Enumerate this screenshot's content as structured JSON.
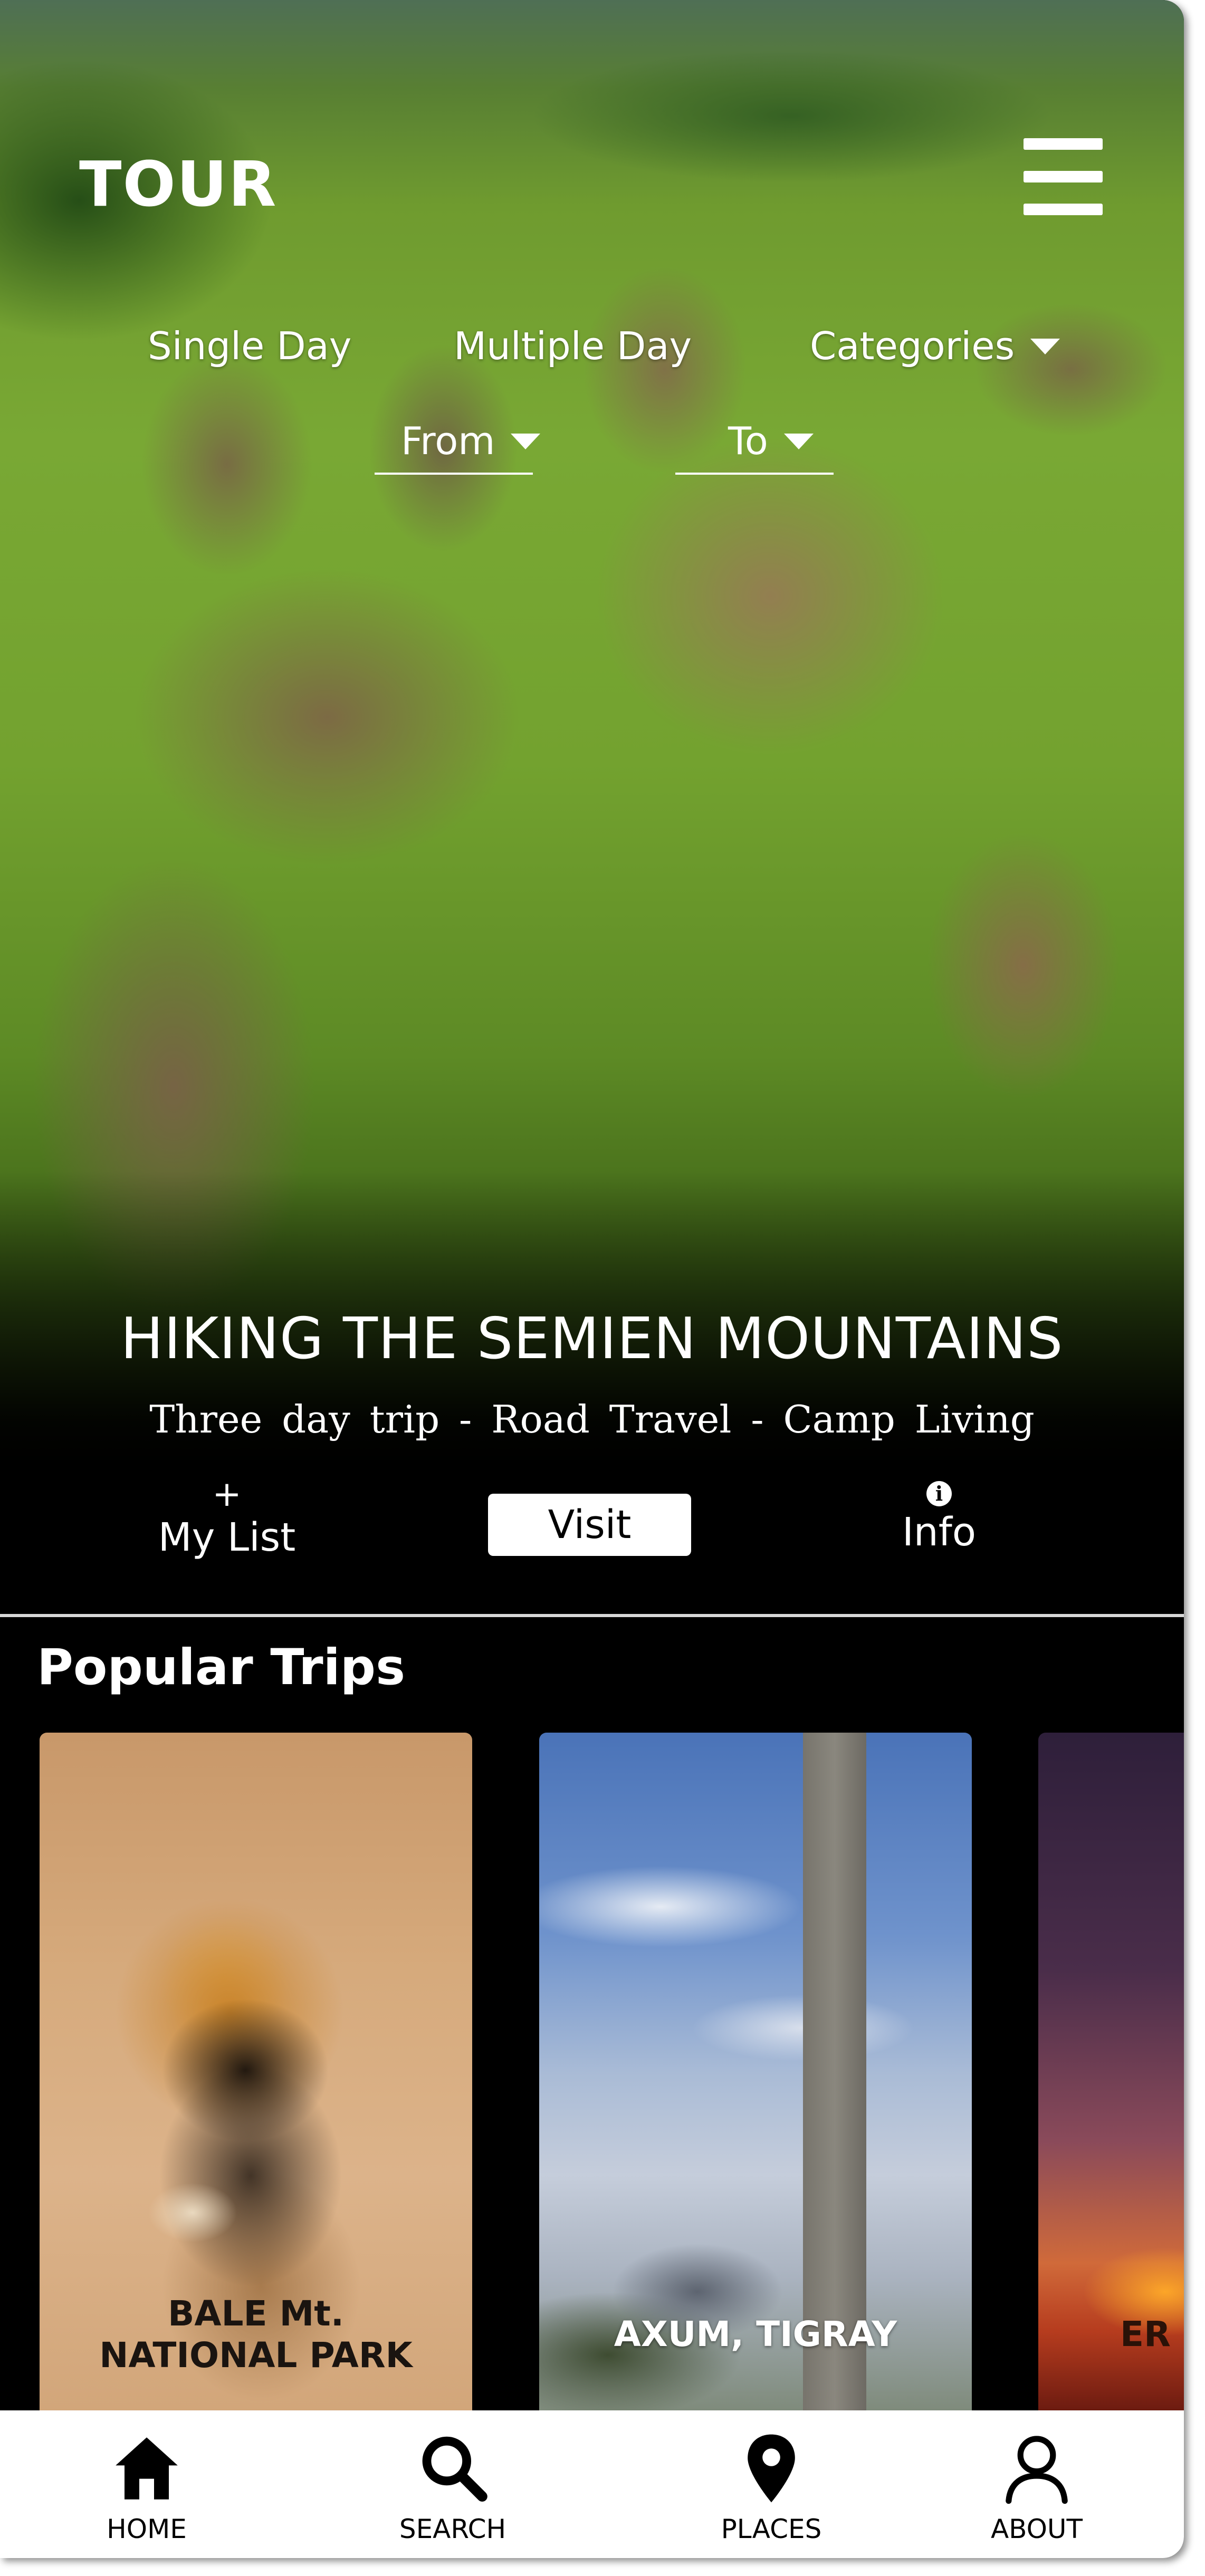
{
  "app": {
    "logo": "TOUR"
  },
  "filters": {
    "tabs": [
      "Single Day",
      "Multiple Day",
      "Categories"
    ],
    "from_label": "From",
    "to_label": "To"
  },
  "hero": {
    "title": "HIKING THE SEMIEN MOUNTAINS",
    "subtitle": "Three day trip  -  Road Travel  -  Camp Living"
  },
  "actions": {
    "add_icon": "+",
    "my_list_label": "My List",
    "visit_label": "Visit",
    "info_icon": "i",
    "info_label": "Info"
  },
  "popular": {
    "title": "Popular Trips",
    "cards": [
      {
        "label": "BALE Mt.\nNATIONAL PARK"
      },
      {
        "label": "AXUM, TIGRAY"
      },
      {
        "label": "ER"
      }
    ]
  },
  "nav": {
    "items": [
      {
        "label": "HOME",
        "icon": "home-icon"
      },
      {
        "label": "SEARCH",
        "icon": "search-icon"
      },
      {
        "label": "PLACES",
        "icon": "map-pin-icon"
      },
      {
        "label": "ABOUT",
        "icon": "user-icon"
      }
    ]
  },
  "colors": {
    "background": "#000000",
    "text_light": "#ffffff",
    "nav_background": "#ffffff",
    "divider": "#d8d8d8"
  }
}
